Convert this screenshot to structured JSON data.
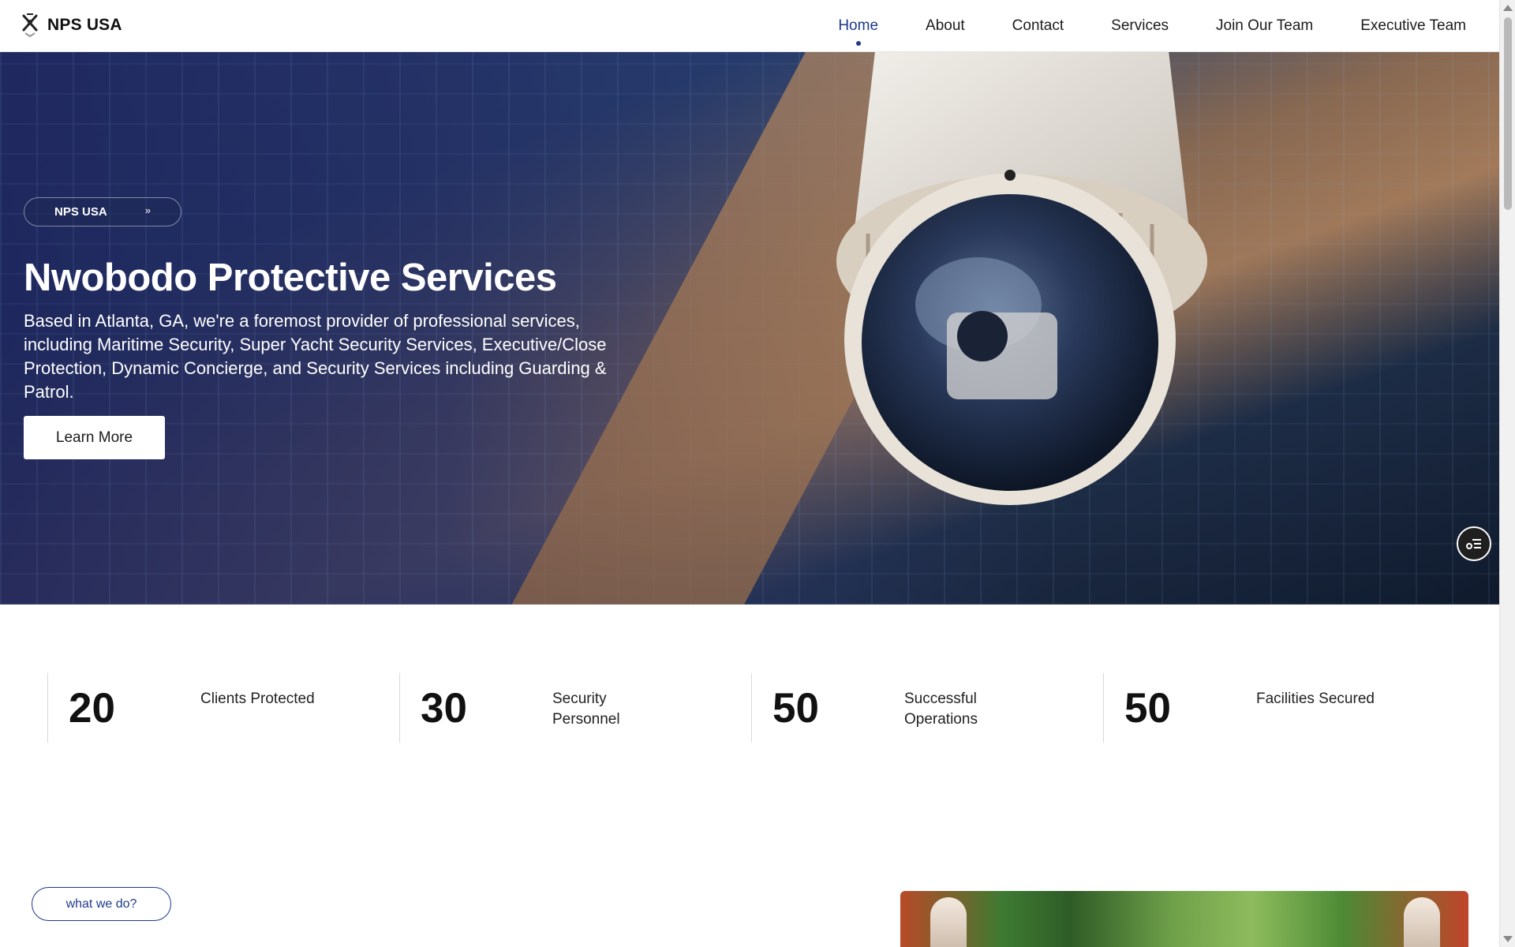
{
  "header": {
    "brand_name": "NPS USA",
    "nav": [
      {
        "label": "Home",
        "active": true
      },
      {
        "label": "About"
      },
      {
        "label": "Contact"
      },
      {
        "label": "Services"
      },
      {
        "label": "Join Our Team"
      },
      {
        "label": "Executive Team"
      }
    ]
  },
  "hero": {
    "pill_label": "NPS USA",
    "pill_icon": "double-chevron-right-icon",
    "title": "Nwobodo Protective Services",
    "description": "Based in Atlanta, GA, we're a foremost provider of professional services, including Maritime Security, Super Yacht Security Services, Executive/Close Protection, Dynamic Concierge, and Security Services including Guarding & Patrol.",
    "cta_label": "Learn More"
  },
  "stats": [
    {
      "value": "20",
      "label": "Clients Protected"
    },
    {
      "value": "30",
      "label": "Security Personnel"
    },
    {
      "value": "50",
      "label": "Successful Operations"
    },
    {
      "value": "50",
      "label": "Facilities Secured"
    }
  ],
  "what_we_do": {
    "pill_label": "what we do?"
  },
  "colors": {
    "accent": "#1e3a8a",
    "hero_overlay": "#1e265c"
  }
}
